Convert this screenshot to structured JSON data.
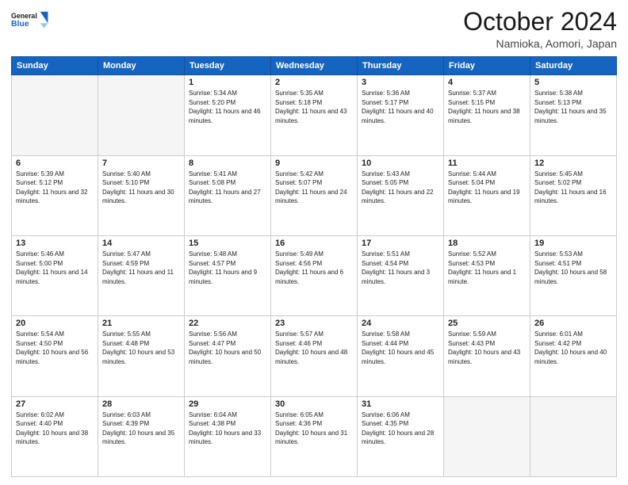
{
  "header": {
    "logo_general": "General",
    "logo_blue": "Blue",
    "main_title": "October 2024",
    "subtitle": "Namioka, Aomori, Japan"
  },
  "weekdays": [
    "Sunday",
    "Monday",
    "Tuesday",
    "Wednesday",
    "Thursday",
    "Friday",
    "Saturday"
  ],
  "weeks": [
    [
      {
        "day": "",
        "sunrise": "",
        "sunset": "",
        "daylight": "",
        "empty": true
      },
      {
        "day": "",
        "sunrise": "",
        "sunset": "",
        "daylight": "",
        "empty": true
      },
      {
        "day": "1",
        "sunrise": "Sunrise: 5:34 AM",
        "sunset": "Sunset: 5:20 PM",
        "daylight": "Daylight: 11 hours and 46 minutes.",
        "empty": false
      },
      {
        "day": "2",
        "sunrise": "Sunrise: 5:35 AM",
        "sunset": "Sunset: 5:18 PM",
        "daylight": "Daylight: 11 hours and 43 minutes.",
        "empty": false
      },
      {
        "day": "3",
        "sunrise": "Sunrise: 5:36 AM",
        "sunset": "Sunset: 5:17 PM",
        "daylight": "Daylight: 11 hours and 40 minutes.",
        "empty": false
      },
      {
        "day": "4",
        "sunrise": "Sunrise: 5:37 AM",
        "sunset": "Sunset: 5:15 PM",
        "daylight": "Daylight: 11 hours and 38 minutes.",
        "empty": false
      },
      {
        "day": "5",
        "sunrise": "Sunrise: 5:38 AM",
        "sunset": "Sunset: 5:13 PM",
        "daylight": "Daylight: 11 hours and 35 minutes.",
        "empty": false
      }
    ],
    [
      {
        "day": "6",
        "sunrise": "Sunrise: 5:39 AM",
        "sunset": "Sunset: 5:12 PM",
        "daylight": "Daylight: 11 hours and 32 minutes.",
        "empty": false
      },
      {
        "day": "7",
        "sunrise": "Sunrise: 5:40 AM",
        "sunset": "Sunset: 5:10 PM",
        "daylight": "Daylight: 11 hours and 30 minutes.",
        "empty": false
      },
      {
        "day": "8",
        "sunrise": "Sunrise: 5:41 AM",
        "sunset": "Sunset: 5:08 PM",
        "daylight": "Daylight: 11 hours and 27 minutes.",
        "empty": false
      },
      {
        "day": "9",
        "sunrise": "Sunrise: 5:42 AM",
        "sunset": "Sunset: 5:07 PM",
        "daylight": "Daylight: 11 hours and 24 minutes.",
        "empty": false
      },
      {
        "day": "10",
        "sunrise": "Sunrise: 5:43 AM",
        "sunset": "Sunset: 5:05 PM",
        "daylight": "Daylight: 11 hours and 22 minutes.",
        "empty": false
      },
      {
        "day": "11",
        "sunrise": "Sunrise: 5:44 AM",
        "sunset": "Sunset: 5:04 PM",
        "daylight": "Daylight: 11 hours and 19 minutes.",
        "empty": false
      },
      {
        "day": "12",
        "sunrise": "Sunrise: 5:45 AM",
        "sunset": "Sunset: 5:02 PM",
        "daylight": "Daylight: 11 hours and 16 minutes.",
        "empty": false
      }
    ],
    [
      {
        "day": "13",
        "sunrise": "Sunrise: 5:46 AM",
        "sunset": "Sunset: 5:00 PM",
        "daylight": "Daylight: 11 hours and 14 minutes.",
        "empty": false
      },
      {
        "day": "14",
        "sunrise": "Sunrise: 5:47 AM",
        "sunset": "Sunset: 4:59 PM",
        "daylight": "Daylight: 11 hours and 11 minutes.",
        "empty": false
      },
      {
        "day": "15",
        "sunrise": "Sunrise: 5:48 AM",
        "sunset": "Sunset: 4:57 PM",
        "daylight": "Daylight: 11 hours and 9 minutes.",
        "empty": false
      },
      {
        "day": "16",
        "sunrise": "Sunrise: 5:49 AM",
        "sunset": "Sunset: 4:56 PM",
        "daylight": "Daylight: 11 hours and 6 minutes.",
        "empty": false
      },
      {
        "day": "17",
        "sunrise": "Sunrise: 5:51 AM",
        "sunset": "Sunset: 4:54 PM",
        "daylight": "Daylight: 11 hours and 3 minutes.",
        "empty": false
      },
      {
        "day": "18",
        "sunrise": "Sunrise: 5:52 AM",
        "sunset": "Sunset: 4:53 PM",
        "daylight": "Daylight: 11 hours and 1 minute.",
        "empty": false
      },
      {
        "day": "19",
        "sunrise": "Sunrise: 5:53 AM",
        "sunset": "Sunset: 4:51 PM",
        "daylight": "Daylight: 10 hours and 58 minutes.",
        "empty": false
      }
    ],
    [
      {
        "day": "20",
        "sunrise": "Sunrise: 5:54 AM",
        "sunset": "Sunset: 4:50 PM",
        "daylight": "Daylight: 10 hours and 56 minutes.",
        "empty": false
      },
      {
        "day": "21",
        "sunrise": "Sunrise: 5:55 AM",
        "sunset": "Sunset: 4:48 PM",
        "daylight": "Daylight: 10 hours and 53 minutes.",
        "empty": false
      },
      {
        "day": "22",
        "sunrise": "Sunrise: 5:56 AM",
        "sunset": "Sunset: 4:47 PM",
        "daylight": "Daylight: 10 hours and 50 minutes.",
        "empty": false
      },
      {
        "day": "23",
        "sunrise": "Sunrise: 5:57 AM",
        "sunset": "Sunset: 4:46 PM",
        "daylight": "Daylight: 10 hours and 48 minutes.",
        "empty": false
      },
      {
        "day": "24",
        "sunrise": "Sunrise: 5:58 AM",
        "sunset": "Sunset: 4:44 PM",
        "daylight": "Daylight: 10 hours and 45 minutes.",
        "empty": false
      },
      {
        "day": "25",
        "sunrise": "Sunrise: 5:59 AM",
        "sunset": "Sunset: 4:43 PM",
        "daylight": "Daylight: 10 hours and 43 minutes.",
        "empty": false
      },
      {
        "day": "26",
        "sunrise": "Sunrise: 6:01 AM",
        "sunset": "Sunset: 4:42 PM",
        "daylight": "Daylight: 10 hours and 40 minutes.",
        "empty": false
      }
    ],
    [
      {
        "day": "27",
        "sunrise": "Sunrise: 6:02 AM",
        "sunset": "Sunset: 4:40 PM",
        "daylight": "Daylight: 10 hours and 38 minutes.",
        "empty": false
      },
      {
        "day": "28",
        "sunrise": "Sunrise: 6:03 AM",
        "sunset": "Sunset: 4:39 PM",
        "daylight": "Daylight: 10 hours and 35 minutes.",
        "empty": false
      },
      {
        "day": "29",
        "sunrise": "Sunrise: 6:04 AM",
        "sunset": "Sunset: 4:38 PM",
        "daylight": "Daylight: 10 hours and 33 minutes.",
        "empty": false
      },
      {
        "day": "30",
        "sunrise": "Sunrise: 6:05 AM",
        "sunset": "Sunset: 4:36 PM",
        "daylight": "Daylight: 10 hours and 31 minutes.",
        "empty": false
      },
      {
        "day": "31",
        "sunrise": "Sunrise: 6:06 AM",
        "sunset": "Sunset: 4:35 PM",
        "daylight": "Daylight: 10 hours and 28 minutes.",
        "empty": false
      },
      {
        "day": "",
        "sunrise": "",
        "sunset": "",
        "daylight": "",
        "empty": true
      },
      {
        "day": "",
        "sunrise": "",
        "sunset": "",
        "daylight": "",
        "empty": true
      }
    ]
  ]
}
